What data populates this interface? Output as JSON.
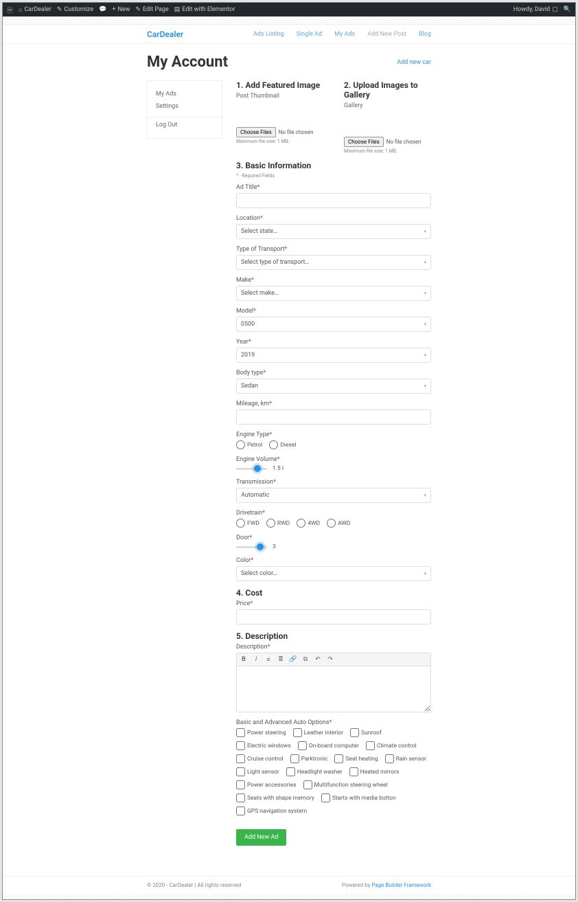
{
  "adminbar": {
    "site": "CarDealer",
    "customize": "Customize",
    "new": "New",
    "edit_page": "Edit Page",
    "edit_elementor": "Edit with Elementor",
    "greeting": "Howdy, David"
  },
  "brand": "CarDealer",
  "nav": {
    "ads_listing": "Ads Listing",
    "single_ad": "Single Ad",
    "my_ads": "My Ads",
    "add_new_post": "Add New Post",
    "blog": "Blog"
  },
  "page_title": "My Account",
  "add_new_car": "Add new car",
  "sidebar": {
    "my_ads": "My Ads",
    "settings": "Settings",
    "logout": "Log Out"
  },
  "sections": {
    "featured": {
      "title": "1. Add Featured Image",
      "sub": "Post Thumbnail",
      "choose": "Choose Files",
      "none": "No file chosen",
      "hint": "Maximum file size: 1 MB."
    },
    "gallery": {
      "title": "2. Upload Images to Gallery",
      "sub": "Gallery",
      "choose": "Choose Files",
      "none": "No file chosen",
      "hint": "Maximum file size: 1 MB."
    },
    "basic": {
      "title": "3. Basic Information",
      "req_note": "* - Required Fields"
    },
    "cost": {
      "title": "4. Cost"
    },
    "desc": {
      "title": "5. Description"
    }
  },
  "fields": {
    "ad_title": "Ad Title",
    "location": "Location",
    "location_val": "Select state…",
    "transport": "Type of Transport",
    "transport_val": "Select type of transport…",
    "make": "Make",
    "make_val": "Select make…",
    "model": "Model",
    "model_val": "0500",
    "year": "Year",
    "year_val": "2019",
    "body": "Body type",
    "body_val": "Sedan",
    "mileage": "Mileage, km",
    "engine_type": "Engine Type",
    "petrol": "Petrol",
    "diesel": "Diesel",
    "engine_vol": "Engine Volume",
    "engine_vol_val": "1.5 l",
    "transmission": "Transmission",
    "transmission_val": "Automatic",
    "drivetrain": "Drivetrain",
    "fwd": "FWD",
    "rwd": "RWD",
    "4wd": "4WD",
    "awd": "AWD",
    "door": "Door",
    "door_val": "3",
    "color": "Color",
    "color_val": "Select color…",
    "price": "Price",
    "description": "Description",
    "options_label": "Basic and Advanced Auto Options"
  },
  "options": [
    "Power steering",
    "Leather interior",
    "Sunroof",
    "Electric windows",
    "On-board computer",
    "Climate control",
    "Cruise control",
    "Parktronic",
    "Seat heating",
    "Rain sensor",
    "Light sensor",
    "Headlight washer",
    "Heated mirrors",
    "Power accessories",
    "Multifunction steering wheel",
    "Seats with shape memory",
    "Starts with media button",
    "GPS navigation system"
  ],
  "submit": "Add New Ad",
  "footer": {
    "left": "© 2020 - CarDealer | All rights reserved",
    "powered": "Powered by ",
    "link": "Page Builder Framework"
  }
}
